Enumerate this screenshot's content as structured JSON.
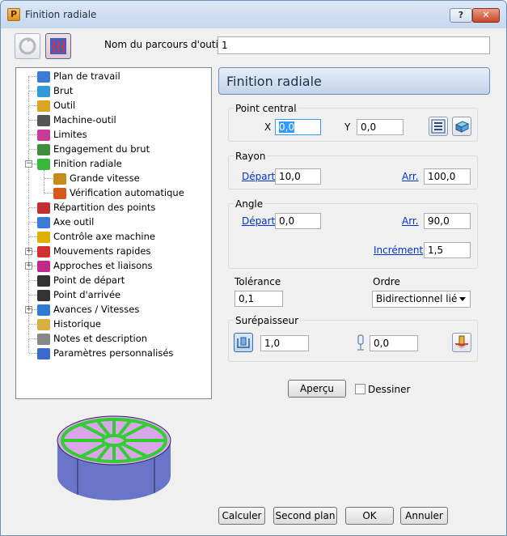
{
  "window": {
    "title": "Finition radiale",
    "app_icon_letter": "P",
    "help_label": "?",
    "close_label": "✕"
  },
  "toolpath_name": {
    "label": "Nom du parcours d'outil",
    "value": "1"
  },
  "tree": {
    "items": [
      {
        "label": "Plan de travail",
        "icon": "workplane-icon",
        "color": "#3a7bd5"
      },
      {
        "label": "Brut",
        "icon": "block-icon",
        "color": "#2e9ad6"
      },
      {
        "label": "Outil",
        "icon": "tool-icon",
        "color": "#d9a520"
      },
      {
        "label": "Machine-outil",
        "icon": "machine-icon",
        "color": "#555555"
      },
      {
        "label": "Limites",
        "icon": "limits-icon",
        "color": "#c63a9a"
      },
      {
        "label": "Engagement du brut",
        "icon": "stock-engagement-icon",
        "color": "#3e8e3e"
      },
      {
        "label": "Finition radiale",
        "icon": "radial-finishing-icon",
        "color": "#38b838"
      },
      {
        "label": "Grande vitesse",
        "icon": "high-speed-icon",
        "color": "#c88a1a"
      },
      {
        "label": "Vérification automatique",
        "icon": "auto-verify-icon",
        "color": "#d85a1a"
      },
      {
        "label": "Répartition des points",
        "icon": "point-distribution-icon",
        "color": "#c03030"
      },
      {
        "label": "Axe outil",
        "icon": "tool-axis-icon",
        "color": "#3a7bd5"
      },
      {
        "label": "Contrôle axe machine",
        "icon": "machine-axis-control-icon",
        "color": "#e0b000"
      },
      {
        "label": "Mouvements rapides",
        "icon": "rapid-moves-icon",
        "color": "#d03030"
      },
      {
        "label": "Approches et liaisons",
        "icon": "leads-links-icon",
        "color": "#c02a8a"
      },
      {
        "label": "Point de départ",
        "icon": "start-point-icon",
        "color": "#333333"
      },
      {
        "label": "Point d'arrivée",
        "icon": "end-point-icon",
        "color": "#333333"
      },
      {
        "label": "Avances / Vitesses",
        "icon": "feeds-speeds-icon",
        "color": "#2e7bd0"
      },
      {
        "label": "Historique",
        "icon": "history-icon",
        "color": "#d8b040"
      },
      {
        "label": "Notes et description",
        "icon": "notes-icon",
        "color": "#888888"
      },
      {
        "label": "Paramètres personnalisés",
        "icon": "user-params-icon",
        "color": "#3a6ad0"
      }
    ]
  },
  "panel": {
    "title": "Finition radiale",
    "center_point": {
      "group_label": "Point central",
      "x_label": "X",
      "x_value": "0,0",
      "y_label": "Y",
      "y_value": "0,0"
    },
    "radius": {
      "group_label": "Rayon",
      "start_label": "Départ",
      "start_value": "10,0",
      "end_label": "Arr.",
      "end_value": "100,0"
    },
    "angle": {
      "group_label": "Angle",
      "start_label": "Départ",
      "start_value": "0,0",
      "end_label": "Arr.",
      "end_value": "90,0",
      "increment_label": "Incrément",
      "increment_value": "1,5"
    },
    "tolerance": {
      "label": "Tolérance",
      "value": "0,1"
    },
    "order": {
      "label": "Ordre",
      "value": "Bidirectionnel lié"
    },
    "thickness": {
      "group_label": "Surépaisseur",
      "radial_value": "1,0",
      "axial_value": "0,0"
    },
    "preview_button": "Aperçu",
    "draw_checkbox_label": "Dessiner"
  },
  "footer": {
    "calculate": "Calculer",
    "queue": "Second plan",
    "ok": "OK",
    "cancel": "Annuler"
  },
  "colors": {
    "preview_top": "#d9a6e8",
    "preview_side": "#6a74c8",
    "preview_path": "#33cc33"
  }
}
